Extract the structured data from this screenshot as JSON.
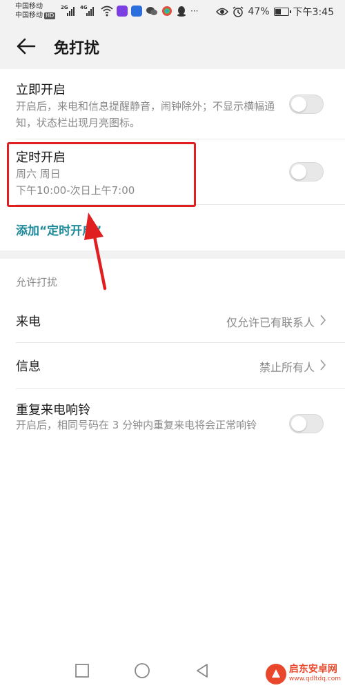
{
  "statusbar": {
    "carrier1": "中国移动",
    "carrier2": "中国移动",
    "hd": "HD",
    "net1": "2G",
    "net2": "4G",
    "more": "···",
    "battery": "47%",
    "battery_level": 0.47,
    "time": "下午3:45"
  },
  "header": {
    "title": "免打扰"
  },
  "immediate": {
    "title": "立即开启",
    "desc": "开启后，来电和信息提醒静音，闹钟除外；不显示横幅通知，状态栏出现月亮图标。",
    "enabled": false
  },
  "scheduled": {
    "title": "定时开启",
    "days": "周六 周日",
    "time_range": "下午10:00-次日上午7:00",
    "enabled": false
  },
  "add_schedule": {
    "label": "添加“定时开启”"
  },
  "allow": {
    "section_label": "允许打扰",
    "calls": {
      "title": "来电",
      "value": "仅允许已有联系人"
    },
    "messages": {
      "title": "信息",
      "value": "禁止所有人"
    },
    "repeat": {
      "title": "重复来电响铃",
      "desc": "开启后，相同号码在 3 分钟内重复来电将会正常响铃",
      "enabled": false
    }
  },
  "watermark": {
    "name": "启东安卓网",
    "url": "www.qdltdq.com"
  },
  "colors": {
    "accent": "#1d8a9a",
    "highlight": "#e02020",
    "toggle_off": "#e8e8e8"
  }
}
